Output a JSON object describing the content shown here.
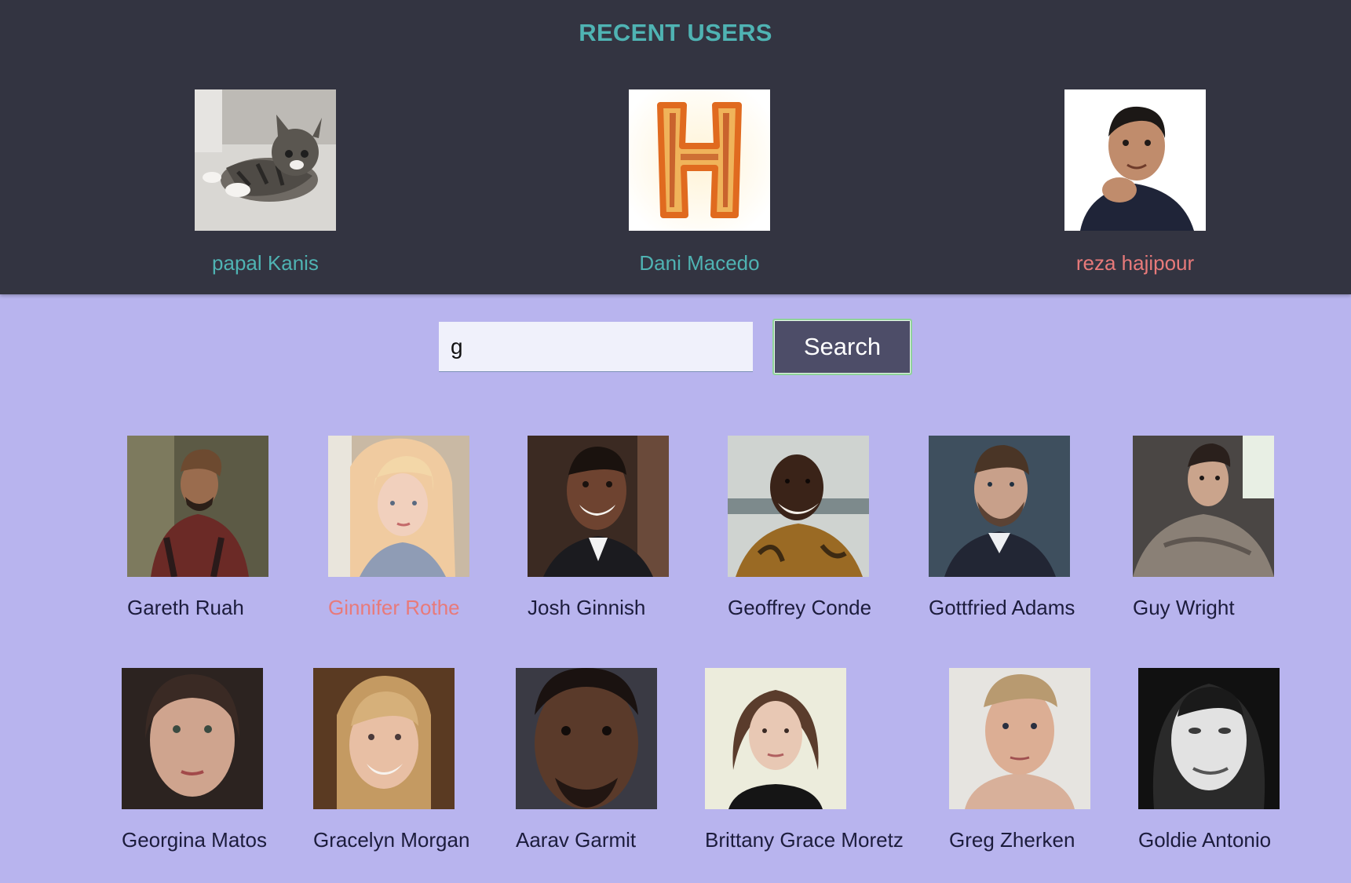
{
  "recent": {
    "title": "RECENT USERS",
    "users": [
      {
        "name": "papal Kanis",
        "avatar": "kitten-photo",
        "name_color": "#4fb3b3"
      },
      {
        "name": "Dani Macedo",
        "avatar": "fire-letter-h-image",
        "name_color": "#4fb3b3"
      },
      {
        "name": "reza hajipour",
        "avatar": "man-portrait-photo",
        "name_color": "#e87a7a"
      }
    ]
  },
  "search": {
    "value": "g",
    "button_label": "Search"
  },
  "results": [
    {
      "name": "Gareth Ruah",
      "name_color": "#1c1c3c"
    },
    {
      "name": "Ginnifer Rothe",
      "name_color": "#e87a7a"
    },
    {
      "name": "Josh Ginnish",
      "name_color": "#1c1c3c"
    },
    {
      "name": "Geoffrey Conde",
      "name_color": "#1c1c3c"
    },
    {
      "name": "Gottfried Adams",
      "name_color": "#1c1c3c"
    },
    {
      "name": "Guy Wright",
      "name_color": "#1c1c3c"
    },
    {
      "name": "Georgina Matos",
      "name_color": "#1c1c3c"
    },
    {
      "name": "Gracelyn Morgan",
      "name_color": "#1c1c3c"
    },
    {
      "name": "Aarav Garmit",
      "name_color": "#1c1c3c"
    },
    {
      "name": "Brittany Grace Moretz",
      "name_color": "#1c1c3c"
    },
    {
      "name": "Greg Zherken",
      "name_color": "#1c1c3c"
    },
    {
      "name": "Goldie Antonio",
      "name_color": "#1c1c3c"
    }
  ]
}
